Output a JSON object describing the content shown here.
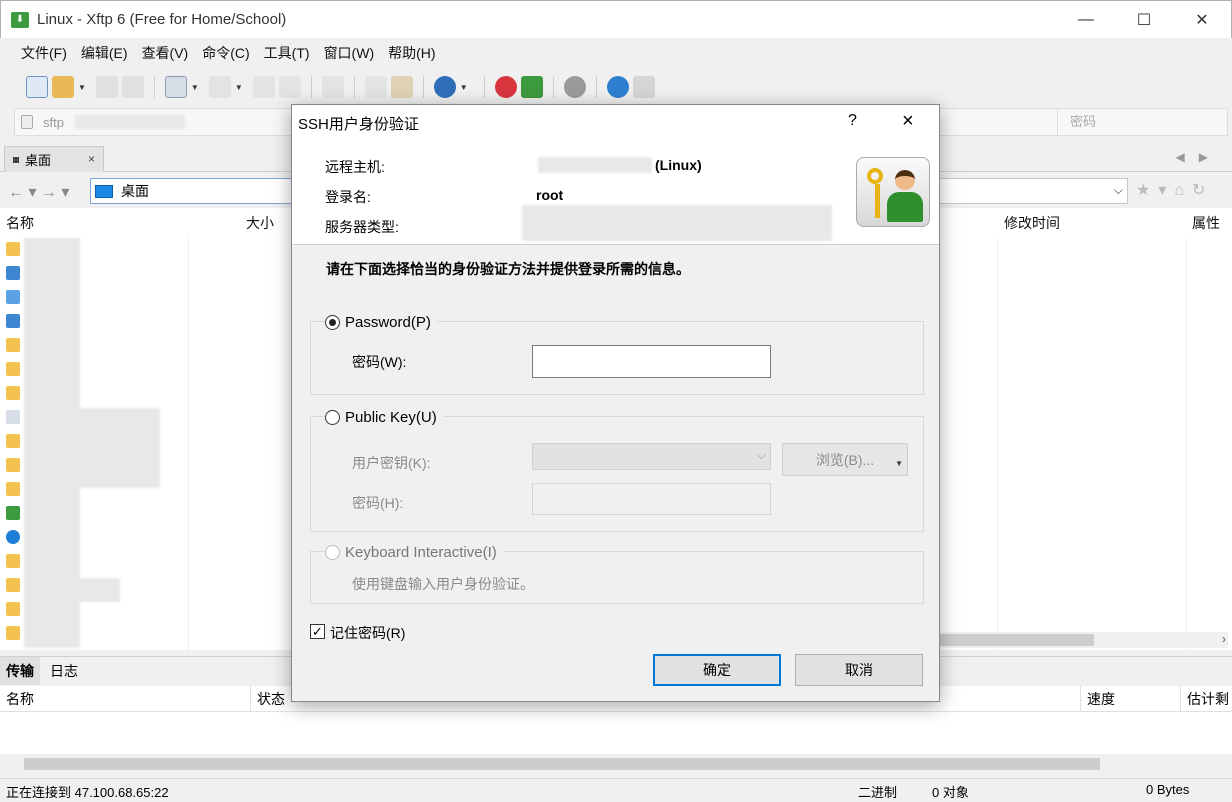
{
  "window": {
    "title": "Linux - Xftp 6 (Free for Home/School)",
    "app_icon": "xftp-app-icon"
  },
  "menu": [
    "文件(F)",
    "编辑(E)",
    "查看(V)",
    "命令(C)",
    "工具(T)",
    "窗口(W)",
    "帮助(H)"
  ],
  "address_bar": {
    "protocol_prefix": "sftp",
    "password_placeholder": "密码"
  },
  "local_tab": {
    "label": "桌面",
    "close": "×"
  },
  "path": {
    "current": "桌面"
  },
  "local_columns": {
    "name": "名称",
    "size": "大小",
    "modified": "修改时间",
    "attr": "属性"
  },
  "transfer": {
    "tabs": [
      "传输",
      "日志"
    ],
    "columns": {
      "name": "名称",
      "status": "状态",
      "speed": "速度",
      "eta": "估计剩"
    }
  },
  "status": {
    "connecting": "正在连接到 47.100.68.65:22",
    "mode": "二进制",
    "objects": "0 对象",
    "bytes": "0 Bytes"
  },
  "dialog": {
    "title": "SSH用户身份验证",
    "help": "?",
    "close": "×",
    "remote_host_label": "远程主机:",
    "remote_host_suffix": "(Linux)",
    "login_label": "登录名:",
    "login_value": "root",
    "server_type_label": "服务器类型:",
    "instruction": "请在下面选择恰当的身份验证方法并提供登录所需的信息。",
    "password_option": "Password(P)",
    "password_label": "密码(W):",
    "pubkey_option": "Public Key(U)",
    "user_key_label": "用户密钥(K):",
    "browse_button": "浏览(B)...",
    "pubkey_password_label": "密码(H):",
    "keyboard_option": "Keyboard Interactive(I)",
    "keyboard_desc": "使用键盘输入用户身份验证。",
    "remember_password": "记住密码(R)",
    "ok_button": "确定",
    "cancel_button": "取消"
  },
  "colors": {
    "accent": "#0078d7",
    "app_green": "#3e9a3e",
    "folder_yellow": "#f2c14e"
  }
}
